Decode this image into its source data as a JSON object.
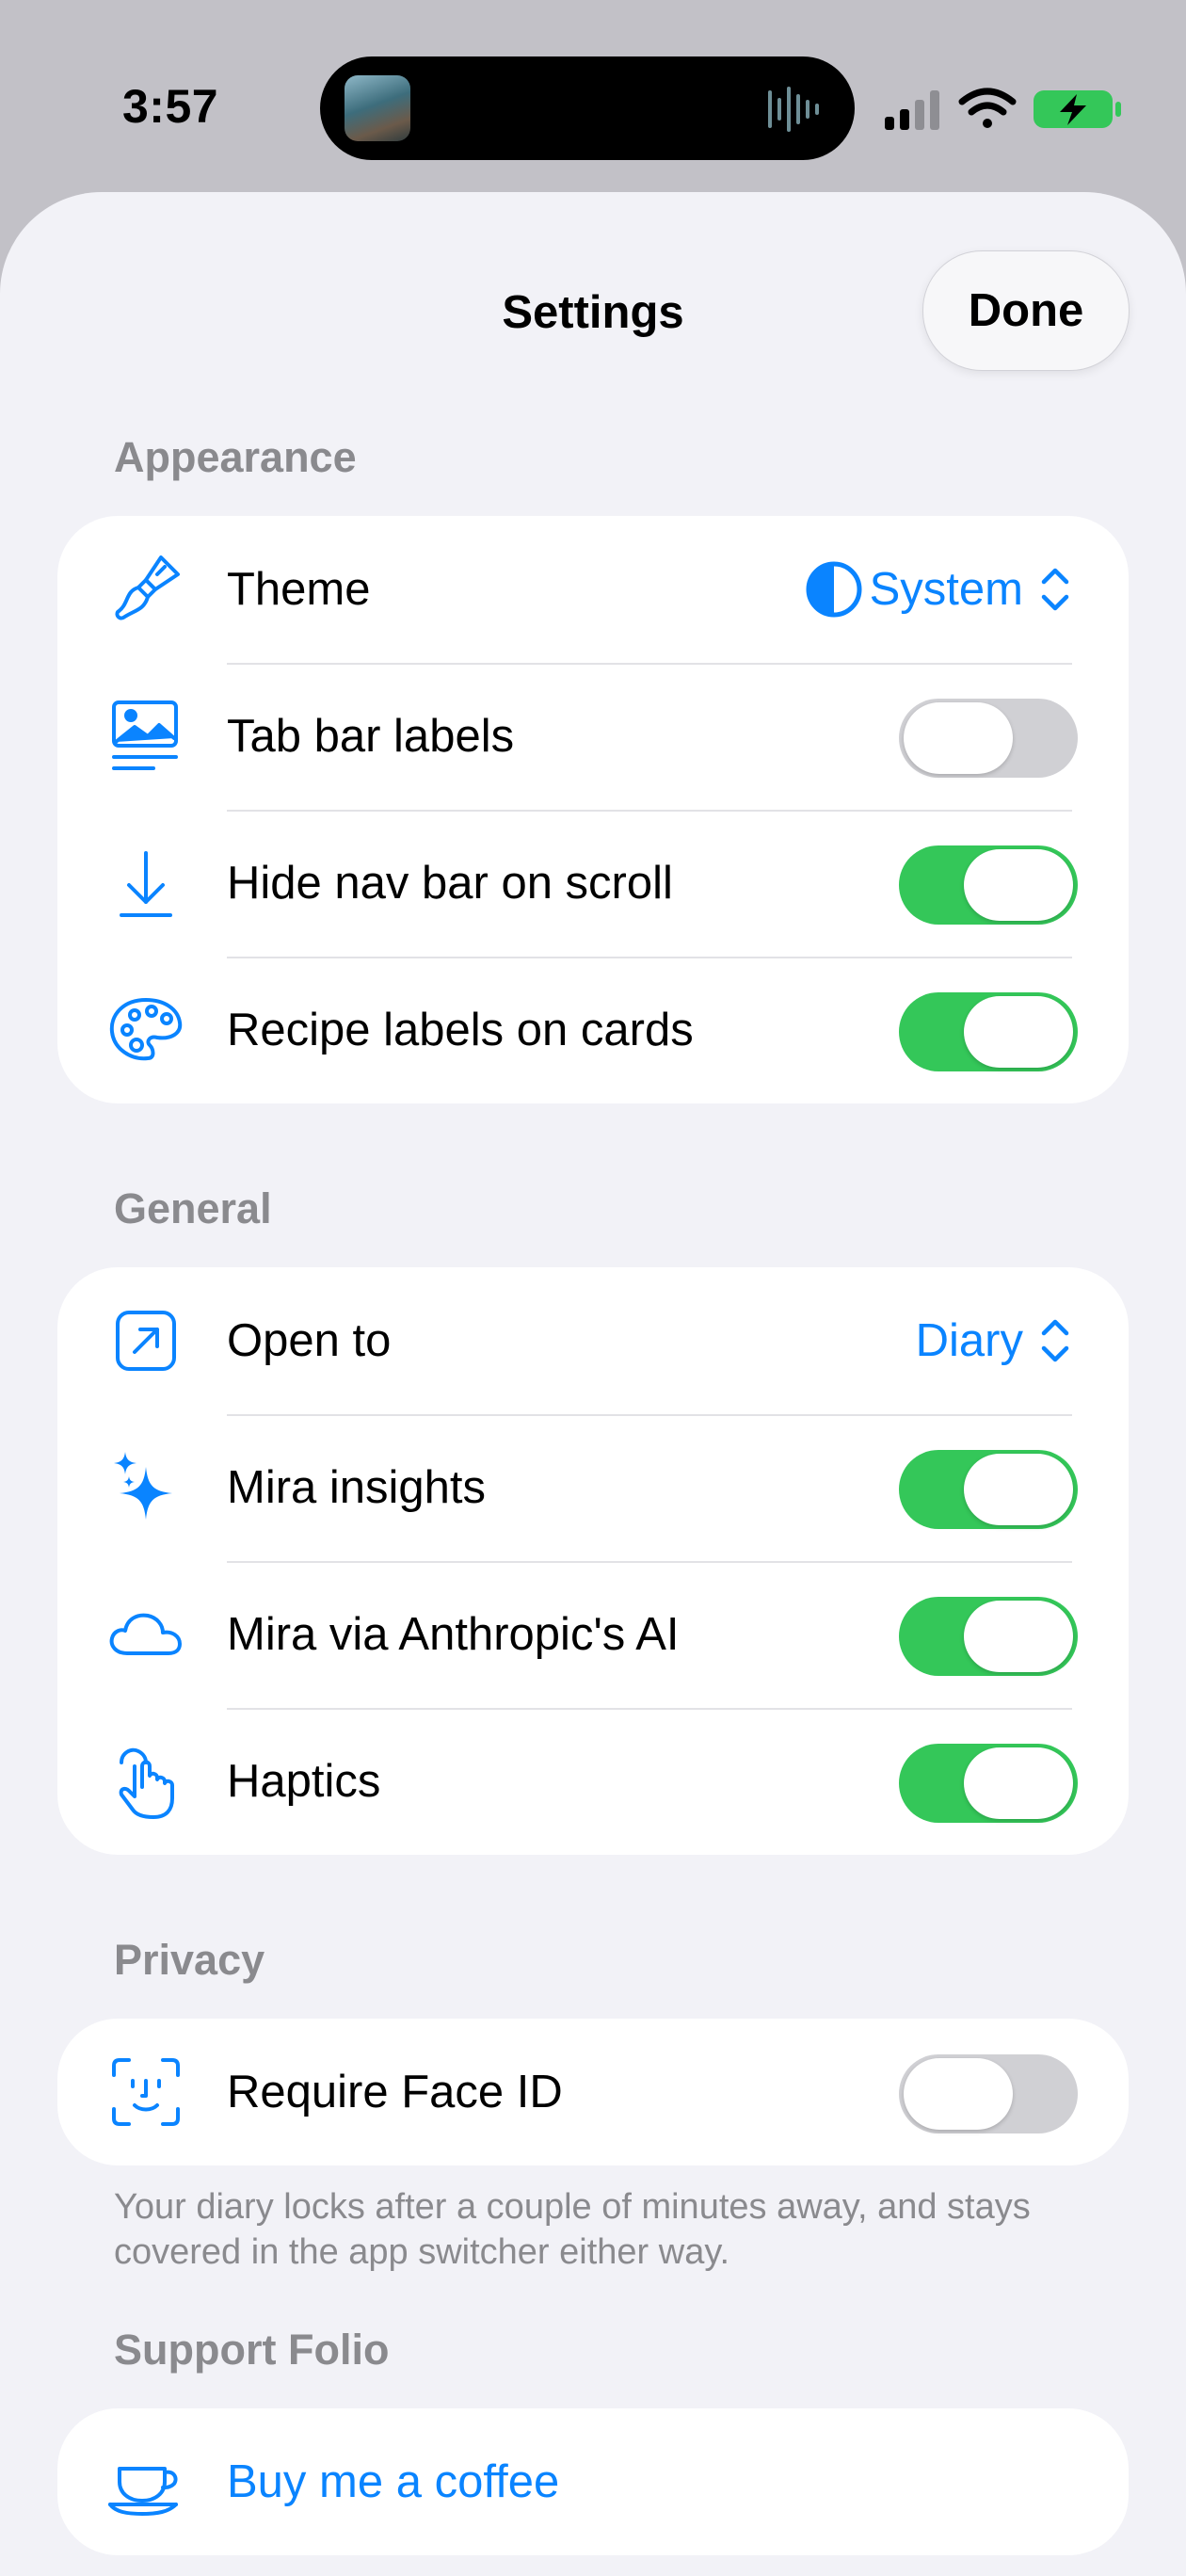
{
  "status_bar": {
    "time": "3:57",
    "battery_color": "#34c759"
  },
  "sheet": {
    "title": "Settings",
    "done_label": "Done"
  },
  "sections": {
    "appearance": {
      "header": "Appearance",
      "theme": {
        "label": "Theme",
        "value": "System",
        "icon": "paintbrush-icon"
      },
      "tab_bar_labels": {
        "label": "Tab bar labels",
        "enabled": false,
        "icon": "photo-text-icon"
      },
      "hide_nav_bar": {
        "label": "Hide nav bar on scroll",
        "enabled": true,
        "icon": "arrow-down-to-line-icon"
      },
      "recipe_labels": {
        "label": "Recipe labels on cards",
        "enabled": true,
        "icon": "palette-icon"
      }
    },
    "general": {
      "header": "General",
      "open_to": {
        "label": "Open to",
        "value": "Diary",
        "icon": "arrow-up-right-square-icon"
      },
      "mira_insights": {
        "label": "Mira insights",
        "enabled": true,
        "icon": "sparkles-icon"
      },
      "mira_ai": {
        "label": "Mira via Anthropic's AI",
        "enabled": true,
        "icon": "cloud-icon"
      },
      "haptics": {
        "label": "Haptics",
        "enabled": true,
        "icon": "hand-tap-icon"
      }
    },
    "privacy": {
      "header": "Privacy",
      "face_id": {
        "label": "Require Face ID",
        "enabled": false,
        "icon": "face-id-icon"
      },
      "footnote": "Your diary locks after a couple of minutes away, and stays covered in the app switcher either way."
    },
    "support": {
      "header": "Support Folio",
      "coffee": {
        "label": "Buy me a coffee",
        "icon": "coffee-cup-icon"
      }
    }
  },
  "colors": {
    "accent": "#0a84ff",
    "toggle_on": "#34c759",
    "toggle_off": "#d0d0d4",
    "background": "#f2f2f7",
    "secondary_text": "#8a8a8e"
  }
}
